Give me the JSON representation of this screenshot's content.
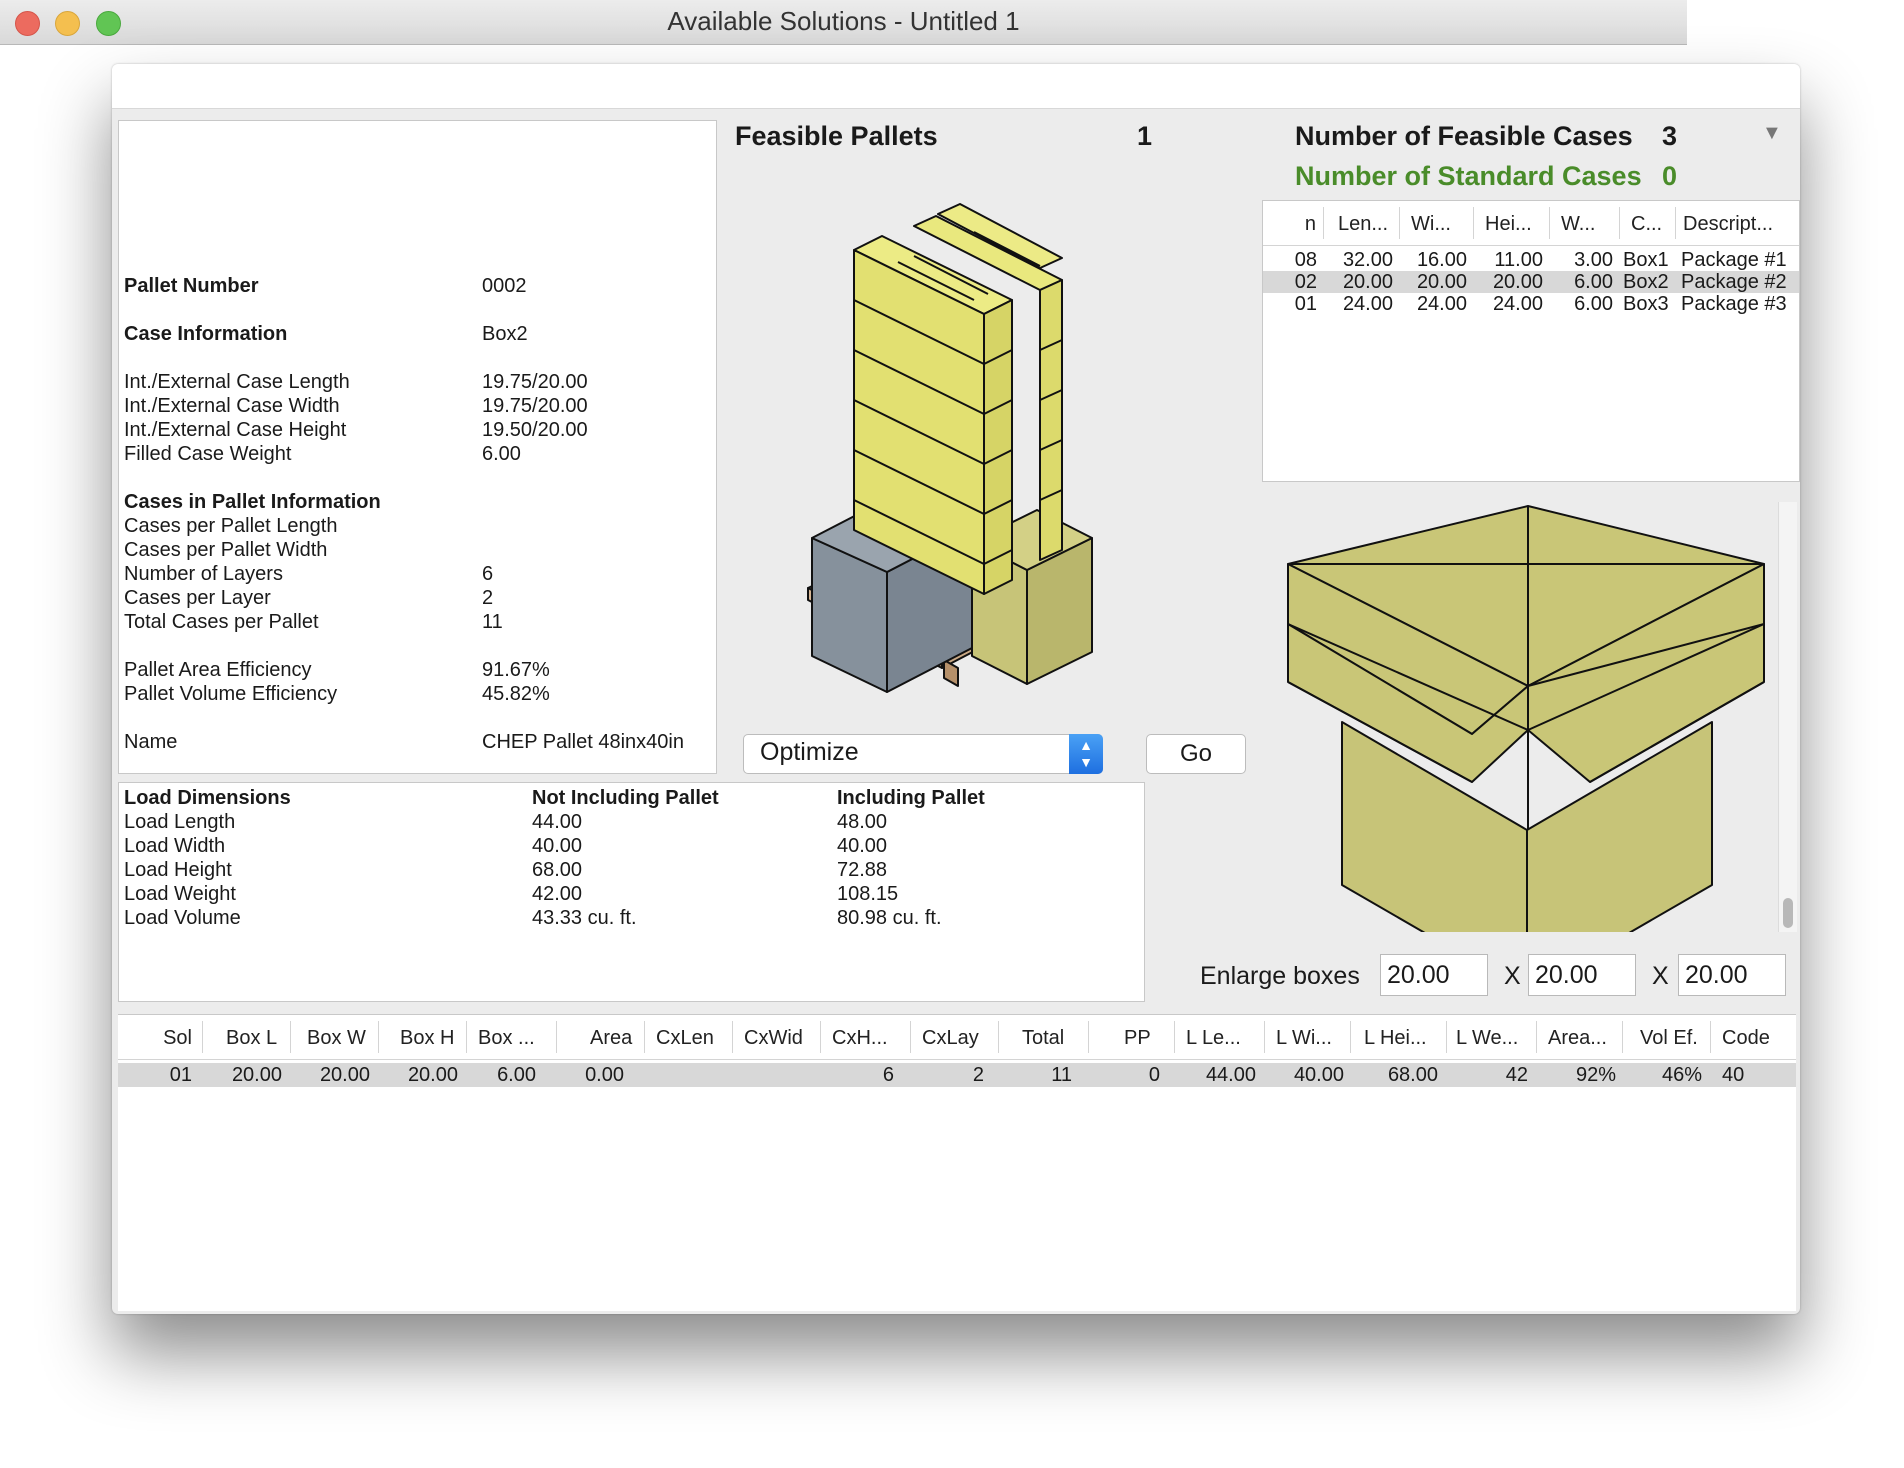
{
  "window": {
    "title": "Available Solutions - Untitled 1"
  },
  "info": {
    "pallet_number_label": "Pallet Number",
    "pallet_number": "0002",
    "case_info_label": "Case Information",
    "case_info": "Box2",
    "rows": [
      {
        "label": "Int./External Case Length",
        "value": "19.75/20.00"
      },
      {
        "label": "Int./External Case Width",
        "value": "19.75/20.00"
      },
      {
        "label": "Int./External Case Height",
        "value": "19.50/20.00"
      },
      {
        "label": "Filled Case Weight",
        "value": "6.00"
      }
    ],
    "cases_heading": "Cases in Pallet Information",
    "cases_rows": [
      {
        "label": "Cases per Pallet Length",
        "value": ""
      },
      {
        "label": "Cases per Pallet Width",
        "value": ""
      },
      {
        "label": "Number of Layers",
        "value": "6"
      },
      {
        "label": "Cases per Layer",
        "value": "2"
      },
      {
        "label": "Total Cases per Pallet",
        "value": "11"
      }
    ],
    "eff_rows": [
      {
        "label": "Pallet Area Efficiency",
        "value": "91.67%"
      },
      {
        "label": "Pallet Volume Efficiency",
        "value": "45.82%"
      }
    ],
    "name_label": "Name",
    "name": "CHEP Pallet 48inx40in"
  },
  "feasible": {
    "label": "Feasible Pallets",
    "count": "1"
  },
  "cases": {
    "feasible_label": "Number of Feasible Cases",
    "feasible_count": "3",
    "standard_label": "Number of Standard Cases",
    "standard_count": "0",
    "standard_color": "#4a8c2a",
    "columns": [
      "n",
      "Len...",
      "Wi...",
      "Hei...",
      "W...",
      "C...",
      "Descript..."
    ],
    "rows": [
      [
        "08",
        "32.00",
        "16.00",
        "11.00",
        "3.00",
        "Box1",
        "Package #1"
      ],
      [
        "02",
        "20.00",
        "20.00",
        "20.00",
        "6.00",
        "Box2",
        "Package #2"
      ],
      [
        "01",
        "24.00",
        "24.00",
        "24.00",
        "6.00",
        "Box3",
        "Package #3"
      ]
    ],
    "selected_row": 1
  },
  "controls": {
    "mode": "Optimize",
    "go": "Go"
  },
  "load": {
    "heading": "Load Dimensions",
    "col1": "Not Including Pallet",
    "col2": "Including Pallet",
    "rows": [
      [
        "Load Length",
        "44.00",
        "48.00"
      ],
      [
        "Load Width",
        "40.00",
        "40.00"
      ],
      [
        "Load Height",
        "68.00",
        "72.88"
      ],
      [
        "Load Weight",
        "42.00",
        "108.15"
      ],
      [
        "Load Volume",
        "43.33 cu. ft.",
        "80.98 cu. ft."
      ]
    ]
  },
  "enlarge": {
    "label": "Enlarge boxes",
    "x": "X",
    "l": "20.00",
    "w": "20.00",
    "h": "20.00"
  },
  "solutions": {
    "columns": [
      "Sol",
      "Box L",
      "Box W",
      "Box H",
      "Box ...",
      "Area",
      "CxLen",
      "CxWid",
      "CxH...",
      "CxLay",
      "Total",
      "PP",
      "L Le...",
      "L Wi...",
      "L Hei...",
      "L We...",
      "Area...",
      "Vol Ef.",
      "Code"
    ],
    "rows": [
      [
        "01",
        "20.00",
        "20.00",
        "20.00",
        "6.00",
        "0.00",
        "",
        "",
        "6",
        "2",
        "11",
        "0",
        "44.00",
        "40.00",
        "68.00",
        "42",
        "92%",
        "46%",
        "40"
      ]
    ]
  },
  "colors": {
    "box_yellow": "#e2e071",
    "box_olive": "#c7c478",
    "box_gray": "#86919c",
    "pallet_wood": "#e6cdb0"
  }
}
